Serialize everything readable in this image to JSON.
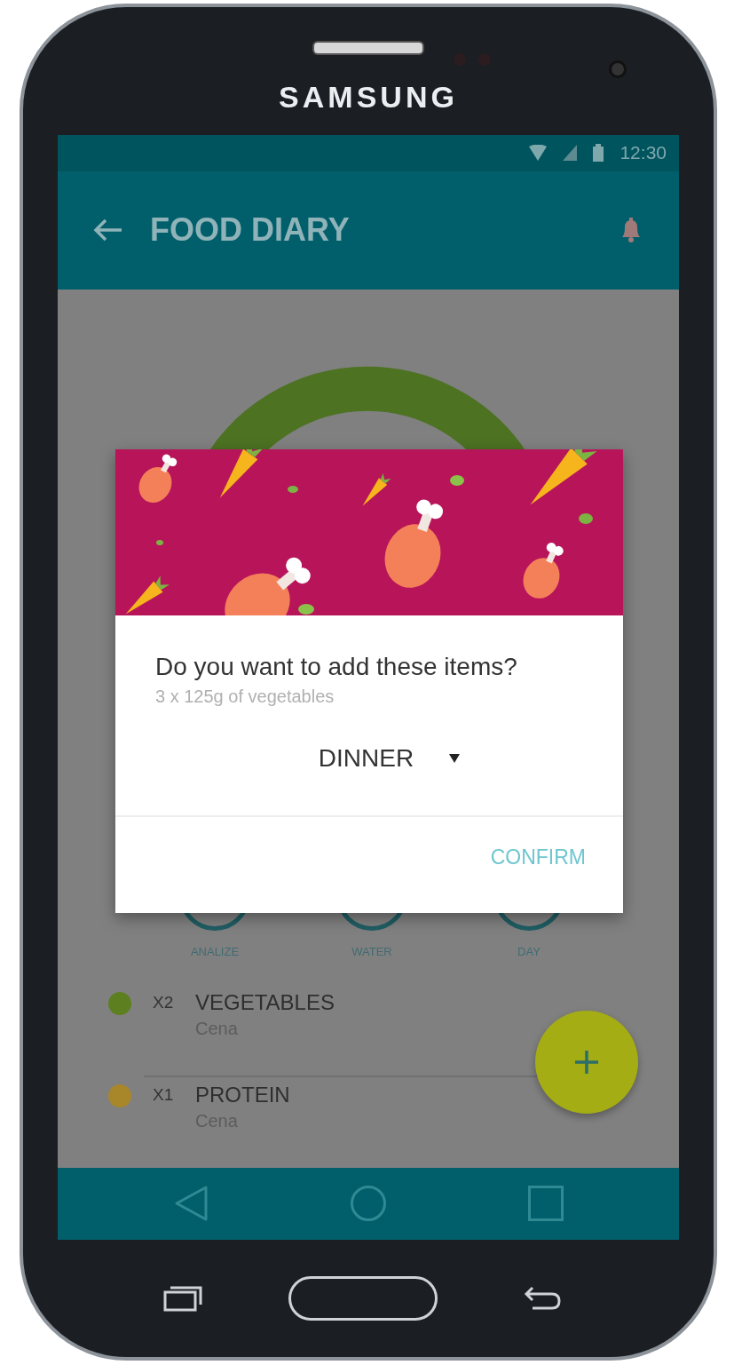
{
  "device": {
    "brand": "SAMSUNG"
  },
  "status_bar": {
    "time": "12:30"
  },
  "app_bar": {
    "title": "FOOD DIARY"
  },
  "shortcuts": [
    {
      "label": "ANALIZE"
    },
    {
      "label": "WATER"
    },
    {
      "label": "DAY"
    }
  ],
  "entries": [
    {
      "color": "#5e7f1f",
      "count": "X2",
      "name": "VEGETABLES",
      "meal": "Cena"
    },
    {
      "color": "#a8862a",
      "count": "X1",
      "name": "PROTEIN",
      "meal": "Cena"
    }
  ],
  "dialog": {
    "title": "Do you want to add these items?",
    "subtitle": "3 x 125g of vegetables",
    "meal_select": {
      "value": "DINNER"
    },
    "confirm": "CONFIRM"
  }
}
